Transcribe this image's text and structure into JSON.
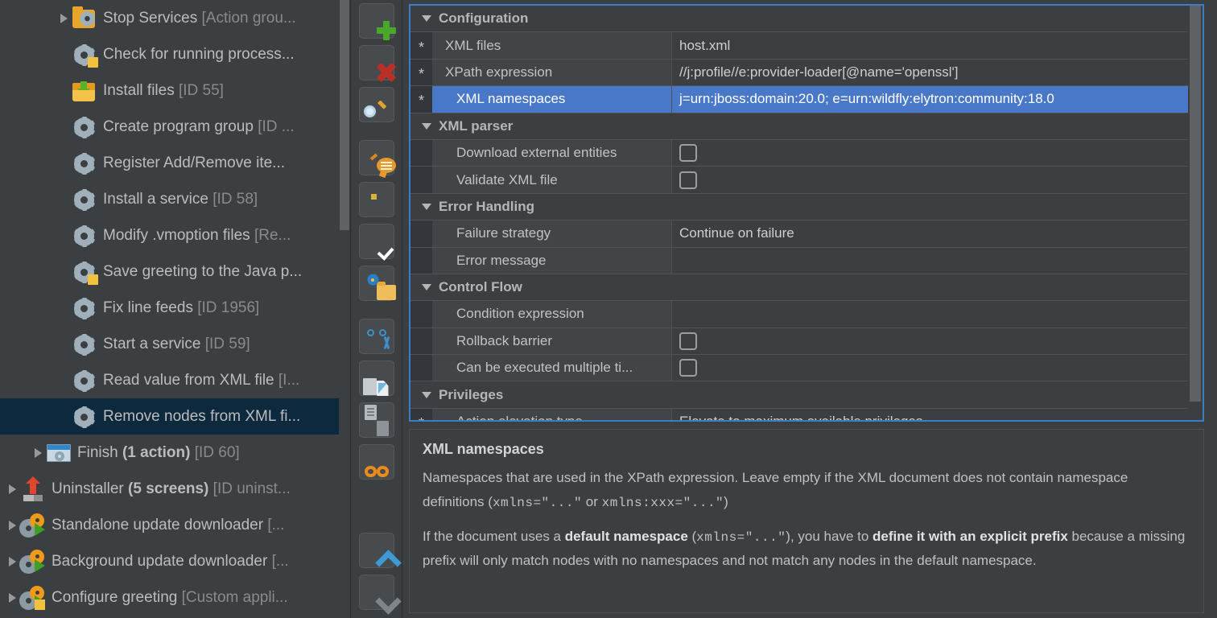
{
  "tree": {
    "items": [
      {
        "label": "Stop Services ",
        "suffix": "[Action grou...",
        "icon": "folder-gear-icon",
        "arrow": true,
        "indent": 2,
        "selected": false
      },
      {
        "label": "Check for running process...",
        "suffix": "",
        "icon": "gear-note-icon",
        "arrow": false,
        "indent": 2,
        "selected": false
      },
      {
        "label": "Install files ",
        "suffix": "[ID 55]",
        "icon": "install-files-icon",
        "arrow": false,
        "indent": 2,
        "selected": false
      },
      {
        "label": "Create program group ",
        "suffix": "[ID ...",
        "icon": "gear-icon",
        "arrow": false,
        "indent": 2,
        "selected": false
      },
      {
        "label": "Register Add/Remove ite...",
        "suffix": "",
        "icon": "gear-icon",
        "arrow": false,
        "indent": 2,
        "selected": false
      },
      {
        "label": "Install a service ",
        "suffix": "[ID 58]",
        "icon": "gear-icon",
        "arrow": false,
        "indent": 2,
        "selected": false
      },
      {
        "label": "Modify .vmoption files ",
        "suffix": "[Re...",
        "icon": "gear-icon",
        "arrow": false,
        "indent": 2,
        "selected": false
      },
      {
        "label": "Save greeting to the Java p...",
        "suffix": "",
        "icon": "gear-note-icon",
        "arrow": false,
        "indent": 2,
        "selected": false
      },
      {
        "label": "Fix line feeds ",
        "suffix": "[ID 1956]",
        "icon": "gear-icon",
        "arrow": false,
        "indent": 2,
        "selected": false
      },
      {
        "label": "Start a service ",
        "suffix": "[ID 59]",
        "icon": "gear-icon",
        "arrow": false,
        "indent": 2,
        "selected": false
      },
      {
        "label": "Read value from XML file ",
        "suffix": "[I...",
        "icon": "gear-icon",
        "arrow": false,
        "indent": 2,
        "selected": false
      },
      {
        "label": "Remove nodes from XML fi...",
        "suffix": "",
        "icon": "gear-icon",
        "arrow": false,
        "indent": 2,
        "selected": true
      },
      {
        "label": "Finish ",
        "bold": "(1 action) ",
        "suffix": "[ID 60]",
        "icon": "window-icon",
        "arrow": true,
        "indent": 1,
        "selected": false
      },
      {
        "label": "Uninstaller ",
        "bold": "(5 screens) ",
        "suffix": "[ID uninst...",
        "icon": "uninstaller-icon",
        "arrow": true,
        "indent": 0,
        "selected": false
      },
      {
        "label": "Standalone update downloader ",
        "suffix": "[...",
        "icon": "updater-icon",
        "arrow": true,
        "indent": 0,
        "selected": false
      },
      {
        "label": "Background update downloader ",
        "suffix": "[...",
        "icon": "updater-icon",
        "arrow": true,
        "indent": 0,
        "selected": false
      },
      {
        "label": "Configure greeting ",
        "suffix": "[Custom appli...",
        "icon": "updater-note-icon",
        "arrow": true,
        "indent": 0,
        "selected": false
      }
    ]
  },
  "toolbar": {
    "buttons": [
      {
        "name": "add-button",
        "glyph": "plus-icon"
      },
      {
        "name": "delete-button",
        "glyph": "x-icon"
      },
      {
        "name": "find-button",
        "glyph": "magnifier-icon"
      },
      {
        "name": "comment-button",
        "glyph": "comment-icon"
      },
      {
        "name": "note-button",
        "glyph": "note-icon"
      },
      {
        "name": "enable-button",
        "glyph": "checkmark-icon"
      },
      {
        "name": "open-folder-button",
        "glyph": "folder-gear-icon"
      },
      {
        "name": "cut-button",
        "glyph": "scissors-icon"
      },
      {
        "name": "copy-button",
        "glyph": "copy-icon"
      },
      {
        "name": "paste-button",
        "glyph": "paste-icon"
      },
      {
        "name": "link-button",
        "glyph": "link-icon"
      },
      {
        "name": "move-up-button",
        "glyph": "chevron-up-icon"
      },
      {
        "name": "move-down-button",
        "glyph": "chevron-down-icon"
      }
    ]
  },
  "properties": {
    "groups": [
      {
        "title": "Configuration",
        "rows": [
          {
            "required": true,
            "name": "XML files",
            "value": "host.xml",
            "type": "text",
            "indent": false,
            "selected": false
          },
          {
            "required": true,
            "name": "XPath expression",
            "value": "//j:profile//e:provider-loader[@name='openssl']",
            "type": "text",
            "indent": false,
            "selected": false
          },
          {
            "required": true,
            "name": "XML namespaces",
            "value": "j=urn:jboss:domain:20.0; e=urn:wildfly:elytron:community:18.0",
            "type": "text",
            "indent": true,
            "selected": true
          }
        ]
      },
      {
        "title": "XML parser",
        "rows": [
          {
            "required": false,
            "name": "Download external entities",
            "value": "",
            "type": "checkbox",
            "checked": false,
            "indent": true,
            "selected": false
          },
          {
            "required": false,
            "name": "Validate XML file",
            "value": "",
            "type": "checkbox",
            "checked": false,
            "indent": true,
            "selected": false
          }
        ]
      },
      {
        "title": "Error Handling",
        "rows": [
          {
            "required": false,
            "name": "Failure strategy",
            "value": "Continue on failure",
            "type": "text",
            "indent": true,
            "selected": false
          },
          {
            "required": false,
            "name": "Error message",
            "value": "",
            "type": "text",
            "indent": true,
            "selected": false
          }
        ]
      },
      {
        "title": "Control Flow",
        "rows": [
          {
            "required": false,
            "name": "Condition expression",
            "value": "",
            "type": "text",
            "indent": true,
            "selected": false
          },
          {
            "required": false,
            "name": "Rollback barrier",
            "value": "",
            "type": "checkbox",
            "checked": false,
            "indent": true,
            "selected": false
          },
          {
            "required": false,
            "name": "Can be executed multiple ti...",
            "value": "",
            "type": "checkbox",
            "checked": false,
            "indent": true,
            "selected": false
          }
        ]
      },
      {
        "title": "Privileges",
        "rows": [
          {
            "required": true,
            "name": "Action elevation type",
            "value": "Elevate to maximum available privileges",
            "type": "text",
            "indent": true,
            "selected": false
          }
        ]
      }
    ],
    "required_marker": "*"
  },
  "description": {
    "title": "XML namespaces",
    "paragraph1_a": "Namespaces that are used in the XPath expression. Leave empty if the XML document does not contain namespace definitions (",
    "paragraph1_code1": "xmlns=\"...\"",
    "paragraph1_b": " or ",
    "paragraph1_code2": "xmlns:xxx=\"...\"",
    "paragraph1_c": ")",
    "paragraph2_a": "If the document uses a ",
    "paragraph2_b1": "default namespace",
    "paragraph2_b": " (",
    "paragraph2_code": "xmlns=\"...\"",
    "paragraph2_c": "), you have to ",
    "paragraph2_b2": "define it with an explicit prefix",
    "paragraph2_d": " because a missing prefix will only match nodes with no namespaces and not match any nodes in the default namespace."
  },
  "colors": {
    "background": "#3c3f41",
    "selection_blue": "#4a78c8",
    "tree_selection": "#0d293e",
    "panel_border": "#3e7ec0",
    "text": "#c2c2c2",
    "muted_text": "#8a8a8a"
  }
}
